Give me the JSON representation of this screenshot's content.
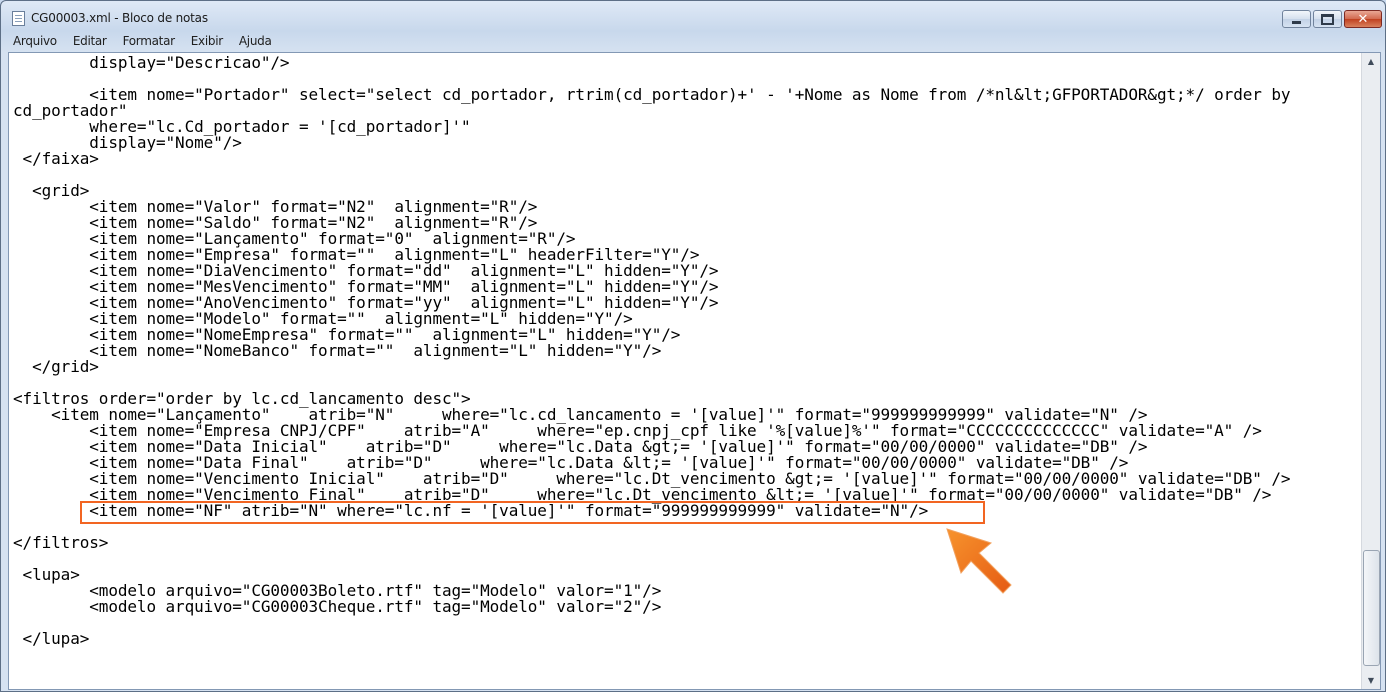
{
  "window": {
    "title": "CG00003.xml - Bloco de notas",
    "controls": {
      "minimize": "─",
      "maximize": "□",
      "close": "✕"
    }
  },
  "menu": [
    "Arquivo",
    "Editar",
    "Formatar",
    "Exibir",
    "Ajuda"
  ],
  "editor": {
    "lines": [
      "        display=\"Descricao\"/>",
      "",
      "        <item nome=\"Portador\" select=\"select cd_portador, rtrim(cd_portador)+' - '+Nome as Nome from /*nl&lt;GFPORTADOR&gt;*/ order by",
      "cd_portador\"",
      "        where=\"lc.Cd_portador = '[cd_portador]'\"",
      "        display=\"Nome\"/>",
      " </faixa>",
      "",
      "  <grid>",
      "        <item nome=\"Valor\" format=\"N2\"  alignment=\"R\"/>",
      "        <item nome=\"Saldo\" format=\"N2\"  alignment=\"R\"/>",
      "        <item nome=\"Lançamento\" format=\"0\"  alignment=\"R\"/>",
      "        <item nome=\"Empresa\" format=\"\"  alignment=\"L\" headerFilter=\"Y\"/>",
      "        <item nome=\"DiaVencimento\" format=\"dd\"  alignment=\"L\" hidden=\"Y\"/>",
      "        <item nome=\"MesVencimento\" format=\"MM\"  alignment=\"L\" hidden=\"Y\"/>",
      "        <item nome=\"AnoVencimento\" format=\"yy\"  alignment=\"L\" hidden=\"Y\"/>",
      "        <item nome=\"Modelo\" format=\"\"  alignment=\"L\" hidden=\"Y\"/>",
      "        <item nome=\"NomeEmpresa\" format=\"\"  alignment=\"L\" hidden=\"Y\"/>",
      "        <item nome=\"NomeBanco\" format=\"\"  alignment=\"L\" hidden=\"Y\"/>",
      "  </grid>",
      "",
      "<filtros order=\"order by lc.cd_lancamento desc\">",
      "    <item nome=\"Lançamento\"    atrib=\"N\"     where=\"lc.cd_lancamento = '[value]'\" format=\"999999999999\" validate=\"N\" />",
      "        <item nome=\"Empresa CNPJ/CPF\"    atrib=\"A\"     where=\"ep.cnpj_cpf like '%[value]%'\" format=\"CCCCCCCCCCCCCC\" validate=\"A\" />",
      "        <item nome=\"Data Inicial\"    atrib=\"D\"     where=\"lc.Data &gt;= '[value]'\" format=\"00/00/0000\" validate=\"DB\" />",
      "        <item nome=\"Data Final\"    atrib=\"D\"     where=\"lc.Data &lt;= '[value]'\" format=\"00/00/0000\" validate=\"DB\" />",
      "        <item nome=\"Vencimento Inicial\"    atrib=\"D\"     where=\"lc.Dt_vencimento &gt;= '[value]'\" format=\"00/00/0000\" validate=\"DB\" />",
      "        <item nome=\"Vencimento Final\"    atrib=\"D\"     where=\"lc.Dt_vencimento &lt;= '[value]'\" format=\"00/00/0000\" validate=\"DB\" />",
      "        <item nome=\"NF\" atrib=\"N\" where=\"lc.nf = '[value]'\" format=\"999999999999\" validate=\"N\"/>",
      "",
      "</filtros>",
      "",
      " <lupa>",
      "        <modelo arquivo=\"CG00003Boleto.rtf\" tag=\"Modelo\" valor=\"1\"/>",
      "        <modelo arquivo=\"CG00003Cheque.rtf\" tag=\"Modelo\" valor=\"2\"/>",
      "",
      " </lupa>"
    ]
  },
  "scrollbar": {
    "up": "▲",
    "down": "▼"
  },
  "colors": {
    "highlight": "#f26522"
  }
}
